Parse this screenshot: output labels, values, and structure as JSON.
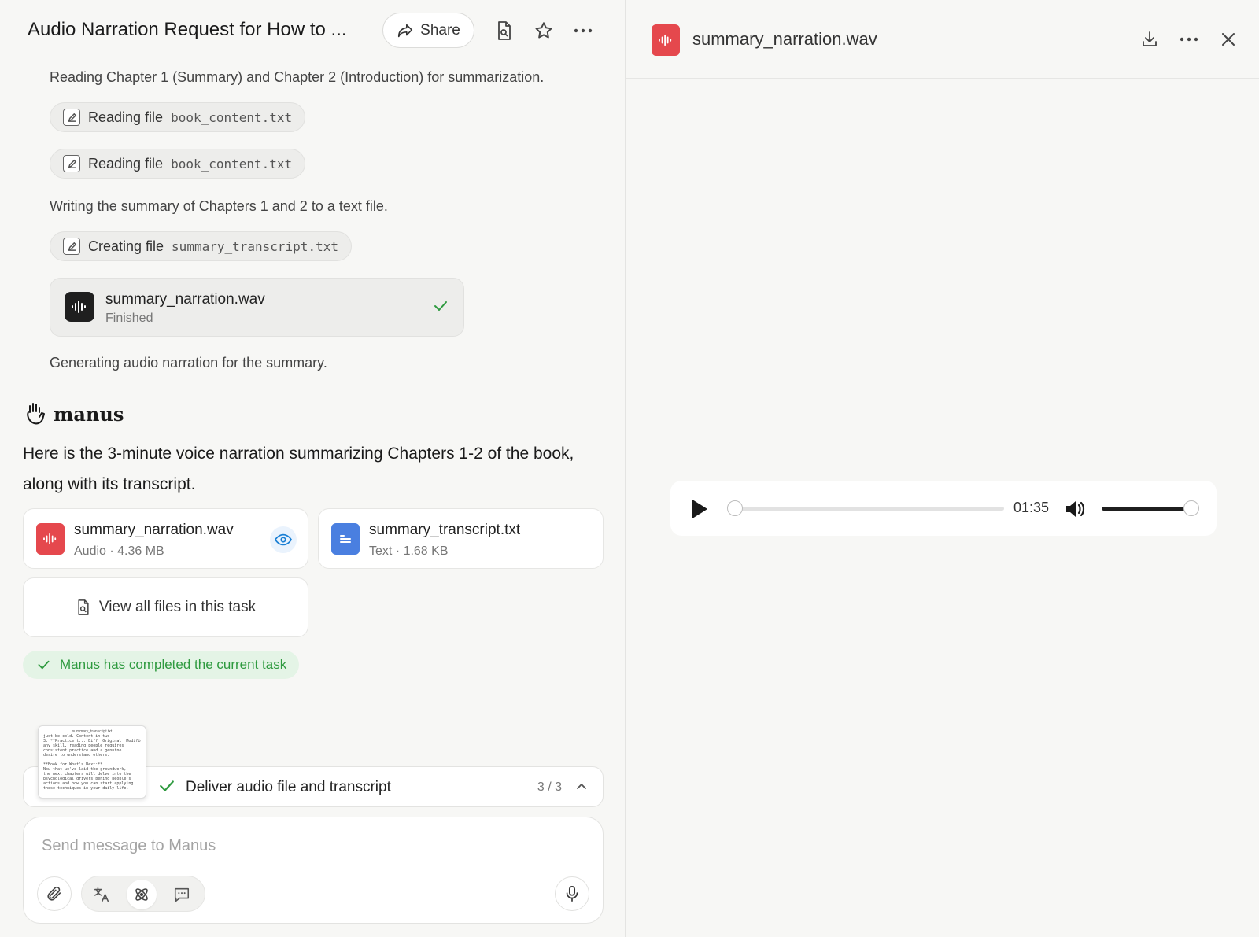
{
  "header": {
    "title": "Audio Narration Request for How to ...",
    "share_label": "Share"
  },
  "progress": {
    "step1_text": "Reading Chapter 1 (Summary) and Chapter 2 (Introduction) for summarization.",
    "chips": [
      {
        "action": "Reading file",
        "file": "book_content.txt"
      },
      {
        "action": "Reading file",
        "file": "book_content.txt"
      },
      {
        "action": "Creating file",
        "file": "summary_transcript.txt"
      }
    ],
    "step2_text": "Writing the summary of Chapters 1 and 2 to a text file.",
    "audio_card": {
      "name": "summary_narration.wav",
      "status": "Finished"
    },
    "step3_text": "Generating audio narration for the summary."
  },
  "assistant": {
    "name": "manus",
    "reply": "Here is the 3-minute voice narration summarizing Chapters 1-2 of the book, along with its transcript."
  },
  "files": [
    {
      "name": "summary_narration.wav",
      "meta": "Audio · 4.36 MB",
      "icon": "audio-file-icon",
      "color": "#e5484d"
    },
    {
      "name": "summary_transcript.txt",
      "meta": "Text · 1.68 KB",
      "icon": "text-file-icon",
      "color": "#4a7fe0"
    }
  ],
  "view_all_label": "View all files in this task",
  "completed_label": "Manus has completed the current task",
  "doc_preview": {
    "title": "summary_transcript.txt",
    "body": "just be cold. Content in two\n3. **Practice t... Diff  Original  Modified\nany skill, reading people requires\nconsistent practice and a genuine\ndesire to understand others.\n\n**Book for What's Next:**\nNow that we've laid the groundwork,\nthe next chapters will delve into the\npsychological drivers behind people's\nactions and how you can start applying\nthese techniques in your daily life."
  },
  "task": {
    "label": "Deliver audio file and transcript",
    "count": "3 / 3"
  },
  "composer": {
    "placeholder": "Send message to Manus"
  },
  "viewer": {
    "title": "summary_narration.wav",
    "time": "01:35",
    "progress": 0,
    "volume": 1.0
  },
  "colors": {
    "accent_green": "#2e9a3f",
    "audio_red": "#e5484d",
    "doc_blue": "#4a7fe0",
    "link_blue": "#1a7fd4"
  }
}
